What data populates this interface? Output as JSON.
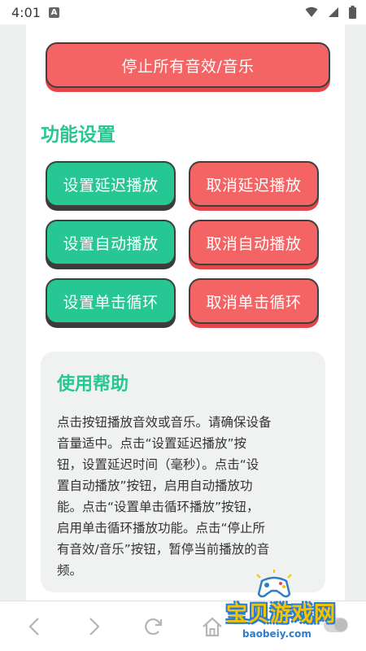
{
  "status_bar": {
    "time": "4:01",
    "notification_glyph": "A",
    "icons": [
      "wifi-icon",
      "signal-icon",
      "battery-icon"
    ]
  },
  "top": {
    "stop_all_label": "停止所有音效/音乐"
  },
  "settings": {
    "title": "功能设置",
    "buttons": [
      {
        "label": "设置延迟播放",
        "color": "#27c794"
      },
      {
        "label": "取消延迟播放",
        "color": "#f46464"
      },
      {
        "label": "设置自动播放",
        "color": "#27c794"
      },
      {
        "label": "取消自动播放",
        "color": "#f46464"
      },
      {
        "label": "设置单击循环",
        "color": "#27c794"
      },
      {
        "label": "取消单击循环",
        "color": "#f46464"
      }
    ]
  },
  "help": {
    "title": "使用帮助",
    "lines": [
      "点击按钮播放音效或音乐。请确保设备",
      "音量适中。点击“设置延迟播放”按",
      "钮，设置延迟时间（毫秒）。点击“设",
      "置自动播放”按钮，启用自动播放功",
      "能。点击“设置单击循环播放”按钮，",
      "启用单击循环播放功能。点击“停止所",
      "有音效/音乐”按钮，暂停当前播放的音",
      "频。"
    ]
  },
  "bottom_nav": {
    "icons": [
      "back-arrow-icon",
      "forward-arrow-icon",
      "refresh-icon",
      "home-icon"
    ]
  },
  "watermark": {
    "text": "宝贝游戏网",
    "domain": "baobeiy.com"
  },
  "colors": {
    "accent_green": "#27c794",
    "accent_red": "#f46464"
  }
}
